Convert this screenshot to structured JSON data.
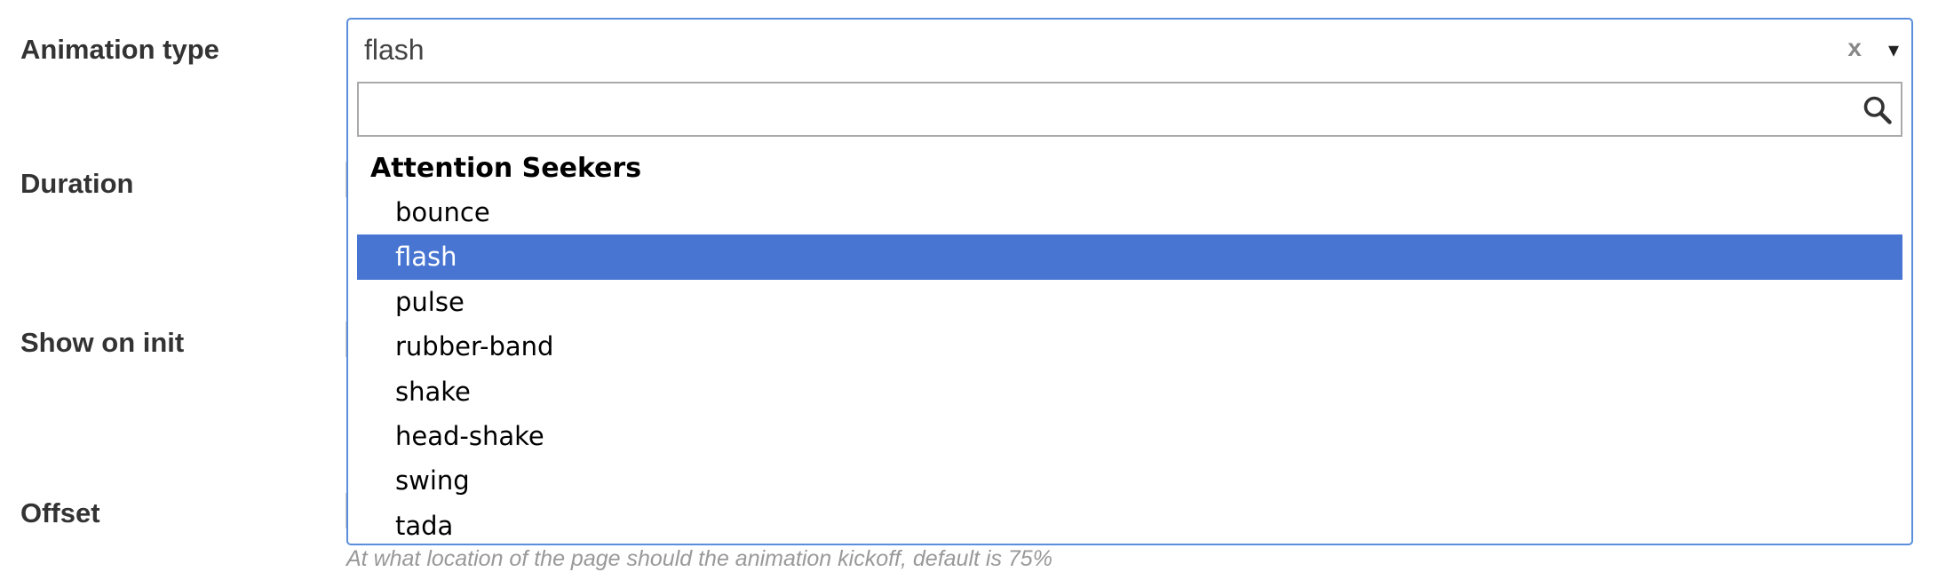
{
  "form": {
    "animation_type_label": "Animation type",
    "duration_label": "Duration",
    "show_on_init_label": "Show on init",
    "offset_label": "Offset",
    "offset_help": "At what location of the page should the animation kickoff, default is 75%"
  },
  "select": {
    "value": "flash",
    "clear_glyph": "x",
    "arrow_glyph": "▾",
    "search_placeholder": "",
    "search_icon": "search-icon",
    "group": "Attention Seekers",
    "options": [
      "bounce",
      "flash",
      "pulse",
      "rubber-band",
      "shake",
      "head-shake",
      "swing",
      "tada"
    ],
    "selected_index": 1
  },
  "colors": {
    "accent": "#4775d1",
    "focus_border": "#5b8edb"
  }
}
